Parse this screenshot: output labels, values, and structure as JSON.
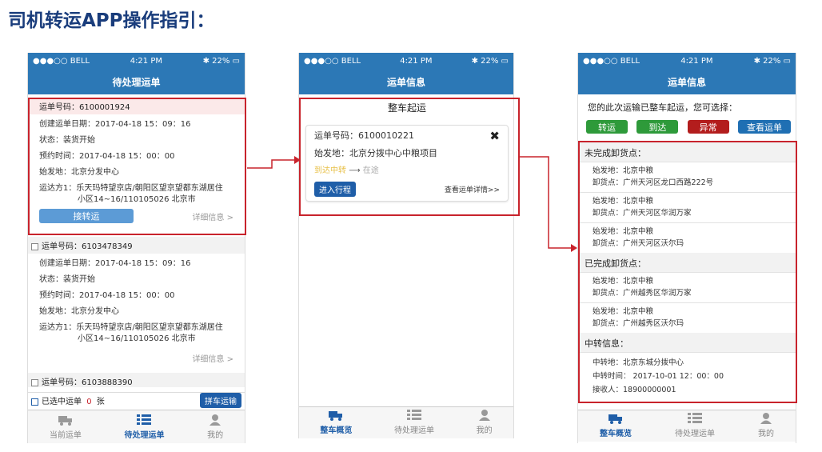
{
  "page_title": "司机转运APP操作指引：",
  "status": {
    "carrier": "●●●○○ BELL",
    "time": "4:21 PM",
    "battery": "22%"
  },
  "screen1": {
    "nav_title": "待处理运单",
    "order1": {
      "order_no": "运单号码：6100001924",
      "created": "创建运单日期：2017-04-18 15：09：16",
      "status": "状态：装货开始",
      "eta": "预约时间：2017-04-18 15：00：00",
      "origin": "始发地：北京分发中心",
      "dest_line1": "运达方1：乐天玛特望京店/朝阳区望京望都东湖居住",
      "dest_line2": "小区14~16/110105026 北京市",
      "accept": "接转运",
      "detail": "详细信息 >"
    },
    "order2": {
      "order_no": "运单号码：6103478349",
      "created": "创建运单日期：2017-04-18 15：09：16",
      "status": "状态：装货开始",
      "eta": "预约时间：2017-04-18 15：00：00",
      "origin": "始发地：北京分发中心",
      "dest_line1": "运达方1：乐天玛特望京店/朝阳区望京望都东湖居住",
      "dest_line2": "小区14~16/110105026 北京市",
      "detail": "详细信息 >"
    },
    "order3": {
      "order_no": "运单号码：6103888390"
    },
    "selected_label": "已选中运单",
    "selected_count": "0",
    "selected_unit": "张",
    "combine_button": "拼车运输",
    "tabs": [
      "当前运单",
      "待处理运单",
      "我的"
    ]
  },
  "screen2": {
    "nav_title": "运单信息",
    "section_title": "整车起运",
    "order_no": "运单号码：6100010221",
    "origin": "始发地：北京分拨中心中粮项目",
    "step_current": "到达中转",
    "step_next": "在途",
    "enter_button": "进入行程",
    "view_detail": "查看运单详情>>",
    "tabs": [
      "整车概览",
      "待处理运单",
      "我的"
    ]
  },
  "screen3": {
    "nav_title": "运单信息",
    "intro": "您的此次运输已整车起运，您可选择：",
    "buttons": [
      "转运",
      "到达",
      "异常",
      "查看运单"
    ],
    "unfinished_title": "未完成卸货点：",
    "unfinished": [
      {
        "origin": "始发地：北京中粮",
        "unload": "卸货点：广州天河区龙口西路222号"
      },
      {
        "origin": "始发地：北京中粮",
        "unload": "卸货点：广州天河区华润万家"
      },
      {
        "origin": "始发地：北京中粮",
        "unload": "卸货点：广州天河区沃尔玛"
      }
    ],
    "finished_title": "已完成卸货点：",
    "finished": [
      {
        "origin": "始发地：北京中粮",
        "unload": "卸货点：广州越秀区华润万家"
      },
      {
        "origin": "始发地：北京中粮",
        "unload": "卸货点：广州越秀区沃尔玛"
      }
    ],
    "transfer_title": "中转信息：",
    "transfer_station": "中转地：北京东城分拨中心",
    "transfer_time": "中转时间：  2017-10-01  12：00：00",
    "receiver": "接收人：18900000001",
    "tabs": [
      "整车概览",
      "待处理运单",
      "我的"
    ]
  },
  "colors": {
    "nav": "#2c78b6",
    "highlight": "#c8232c",
    "title": "#1a3d7c"
  }
}
